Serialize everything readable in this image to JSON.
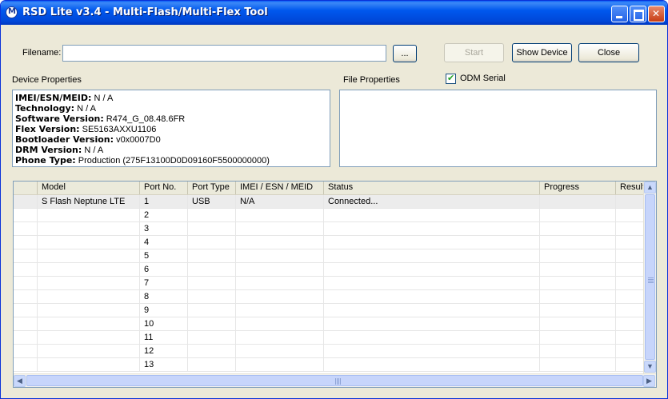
{
  "window": {
    "title": "RSD Lite v3.4 - Multi-Flash/Multi-Flex Tool"
  },
  "filename": {
    "label": "Filename:",
    "value": "",
    "browse_label": "..."
  },
  "buttons": {
    "start": "Start",
    "show_device": "Show Device",
    "close": "Close"
  },
  "device_properties": {
    "label": "Device Properties",
    "items": [
      {
        "key": "IMEI/ESN/MEID:",
        "value": "N / A"
      },
      {
        "key": "Technology:",
        "value": "N / A"
      },
      {
        "key": "Software Version:",
        "value": "R474_G_08.48.6FR"
      },
      {
        "key": "Flex Version:",
        "value": "SE5163AXXU1106"
      },
      {
        "key": "Bootloader Version:",
        "value": "v0x0007D0"
      },
      {
        "key": "DRM Version:",
        "value": "N / A"
      },
      {
        "key": "Phone Type:",
        "value": "Production (275F13100D0D09160F5500000000)"
      }
    ]
  },
  "file_properties": {
    "label": "File Properties"
  },
  "odm_serial": {
    "label": "ODM Serial",
    "checked": true
  },
  "table": {
    "columns": [
      "",
      "Model",
      "Port No.",
      "Port Type",
      "IMEI / ESN / MEID",
      "Status",
      "Progress",
      "Result"
    ],
    "rows": [
      [
        "",
        "S Flash Neptune LTE",
        "1",
        "USB",
        "N/A",
        "Connected...",
        "",
        ""
      ],
      [
        "",
        "",
        "2",
        "",
        "",
        "",
        "",
        ""
      ],
      [
        "",
        "",
        "3",
        "",
        "",
        "",
        "",
        ""
      ],
      [
        "",
        "",
        "4",
        "",
        "",
        "",
        "",
        ""
      ],
      [
        "",
        "",
        "5",
        "",
        "",
        "",
        "",
        ""
      ],
      [
        "",
        "",
        "6",
        "",
        "",
        "",
        "",
        ""
      ],
      [
        "",
        "",
        "7",
        "",
        "",
        "",
        "",
        ""
      ],
      [
        "",
        "",
        "8",
        "",
        "",
        "",
        "",
        ""
      ],
      [
        "",
        "",
        "9",
        "",
        "",
        "",
        "",
        ""
      ],
      [
        "",
        "",
        "10",
        "",
        "",
        "",
        "",
        ""
      ],
      [
        "",
        "",
        "11",
        "",
        "",
        "",
        "",
        ""
      ],
      [
        "",
        "",
        "12",
        "",
        "",
        "",
        "",
        ""
      ],
      [
        "",
        "",
        "13",
        "",
        "",
        "",
        "",
        ""
      ]
    ]
  }
}
